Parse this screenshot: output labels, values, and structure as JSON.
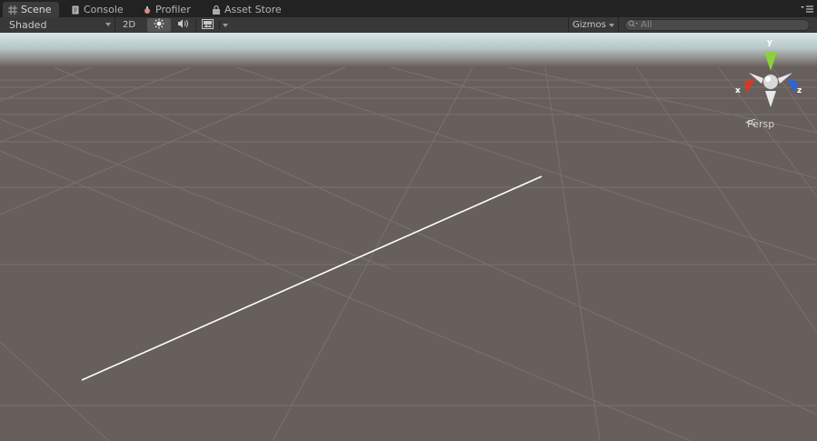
{
  "tabs": [
    {
      "label": "Scene",
      "icon": "scene-grid-icon",
      "active": true
    },
    {
      "label": "Console",
      "icon": "console-icon",
      "active": false
    },
    {
      "label": "Profiler",
      "icon": "profiler-icon",
      "active": false
    },
    {
      "label": "Asset Store",
      "icon": "asset-store-icon",
      "active": false
    }
  ],
  "toolbar": {
    "shading_mode": "Shaded",
    "mode_2d_label": "2D",
    "lighting_icon": "sun-icon",
    "audio_icon": "audio-icon",
    "effects_icon": "image-icon",
    "gizmos_label": "Gizmos",
    "search_placeholder": "All"
  },
  "gizmo": {
    "axis_y": "y",
    "axis_x": "x",
    "axis_z": "z",
    "projection_label": "Persp"
  },
  "colors": {
    "ground": "#675f5b",
    "sky_top": "#c9dcdf",
    "axis_y": "#8bd13c",
    "axis_x": "#d23a2a",
    "axis_z": "#2f63d6",
    "line": "#ffffff"
  }
}
